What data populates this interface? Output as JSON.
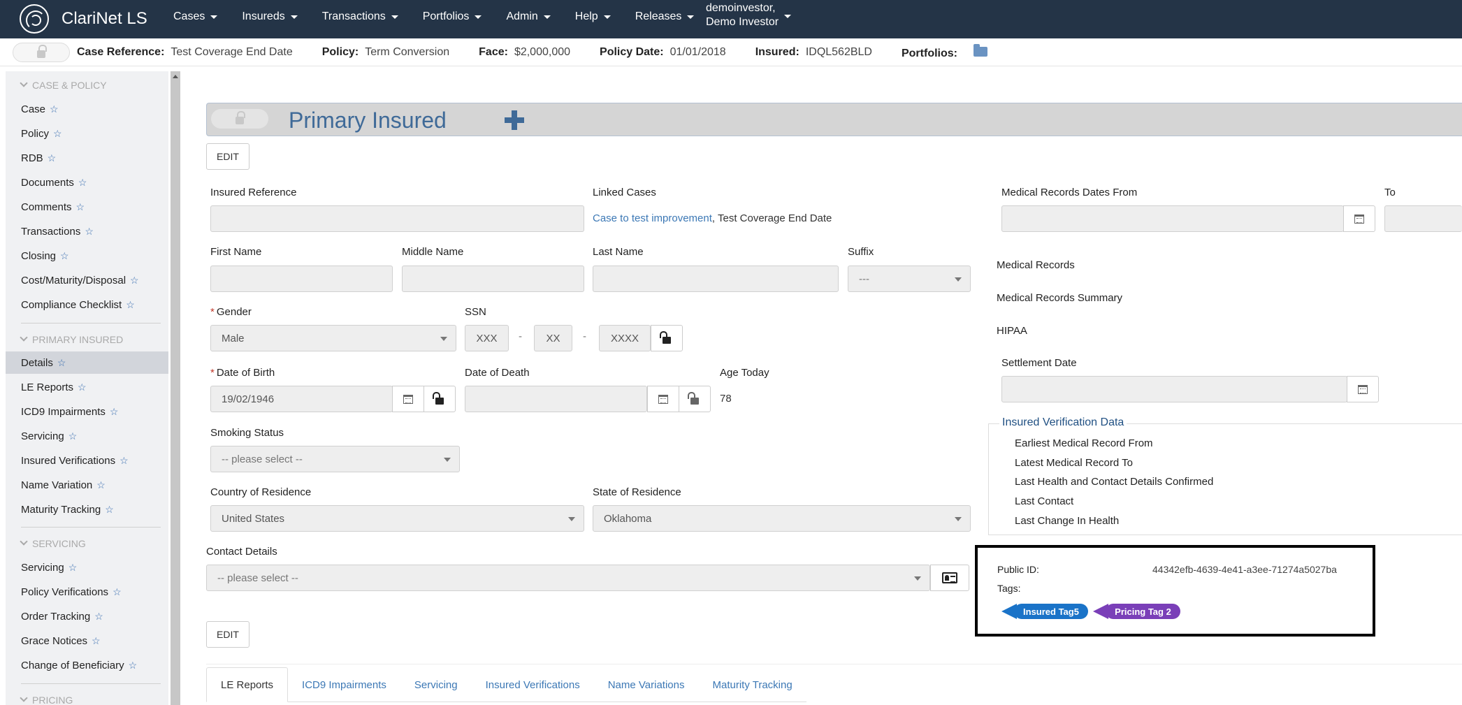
{
  "app": {
    "name": "ClariNet LS"
  },
  "nav": {
    "menus": [
      "Cases",
      "Insureds",
      "Transactions",
      "Portfolios",
      "Admin",
      "Help",
      "Releases"
    ],
    "user_line1": "demoinvestor,",
    "user_line2": "Demo Investor"
  },
  "infobar": {
    "case_reference_label": "Case Reference:",
    "case_reference_value": "Test Coverage End Date",
    "policy_label": "Policy:",
    "policy_value": "Term Conversion",
    "face_label": "Face:",
    "face_value": "$2,000,000",
    "policy_date_label": "Policy Date:",
    "policy_date_value": "01/01/2018",
    "insured_label": "Insured:",
    "insured_value": "IDQL562BLD",
    "portfolios_label": "Portfolios:"
  },
  "sidebar": {
    "sections": [
      {
        "title": "CASE & POLICY",
        "items": [
          "Case",
          "Policy",
          "RDB",
          "Documents",
          "Comments",
          "Transactions",
          "Closing",
          "Cost/Maturity/Disposal",
          "Compliance Checklist"
        ]
      },
      {
        "title": "PRIMARY INSURED",
        "items": [
          "Details",
          "LE Reports",
          "ICD9 Impairments",
          "Servicing",
          "Insured Verifications",
          "Name Variation",
          "Maturity Tracking"
        ]
      },
      {
        "title": "SERVICING",
        "items": [
          "Servicing",
          "Policy Verifications",
          "Order Tracking",
          "Grace Notices",
          "Change of Beneficiary"
        ]
      },
      {
        "title": "PRICING",
        "items": []
      }
    ],
    "active_item": "Details",
    "star": "☆"
  },
  "panel": {
    "title": "Primary Insured",
    "edit_label": "EDIT"
  },
  "form": {
    "insured_reference_label": "Insured Reference",
    "insured_reference_value": "",
    "linked_cases_label": "Linked Cases",
    "linked_case_link": "Case to test improvement",
    "linked_case_rest": ", Test Coverage End Date",
    "first_name_label": "First Name",
    "middle_name_label": "Middle Name",
    "last_name_label": "Last Name",
    "suffix_label": "Suffix",
    "suffix_value": "---",
    "gender_label": "Gender",
    "gender_value": "Male",
    "ssn_label": "SSN",
    "ssn_part1": "XXX",
    "ssn_part2": "XX",
    "ssn_part3": "XXXX",
    "ssn_sep": "-",
    "dob_label": "Date of Birth",
    "dob_value": "19/02/1946",
    "dod_label": "Date of Death",
    "dod_value": "",
    "age_today_label": "Age Today",
    "age_today_value": "78",
    "smoking_label": "Smoking Status",
    "smoking_value": "-- please select --",
    "country_label": "Country of Residence",
    "country_value": "United States",
    "state_label": "State of Residence",
    "state_value": "Oklahoma",
    "contact_label": "Contact Details",
    "contact_value": "-- please select --"
  },
  "medical": {
    "dates_from_label": "Medical Records Dates From",
    "to_label": "To",
    "medical_records_label": "Medical Records",
    "summary_label": "Medical Records Summary",
    "hipaa_label": "HIPAA",
    "settlement_date_label": "Settlement Date"
  },
  "verification": {
    "title": "Insured Verification Data",
    "rows": [
      "Earliest Medical Record From",
      "Latest Medical Record To",
      "Last Health and Contact Details Confirmed",
      "Last Contact",
      "Last Change In Health"
    ]
  },
  "meta_box": {
    "public_id_label": "Public ID:",
    "public_id_value": "44342efb-4639-4e41-a3ee-71274a5027ba",
    "tags_label": "Tags:",
    "tags": [
      {
        "label": "Insured Tag5",
        "color": "#1a73c8"
      },
      {
        "label": "Pricing Tag 2",
        "color": "#7a3fb8"
      }
    ]
  },
  "tabs": [
    "LE Reports",
    "ICD9 Impairments",
    "Servicing",
    "Insured Verifications",
    "Name Variations",
    "Maturity Tracking"
  ],
  "active_tab": "LE Reports"
}
